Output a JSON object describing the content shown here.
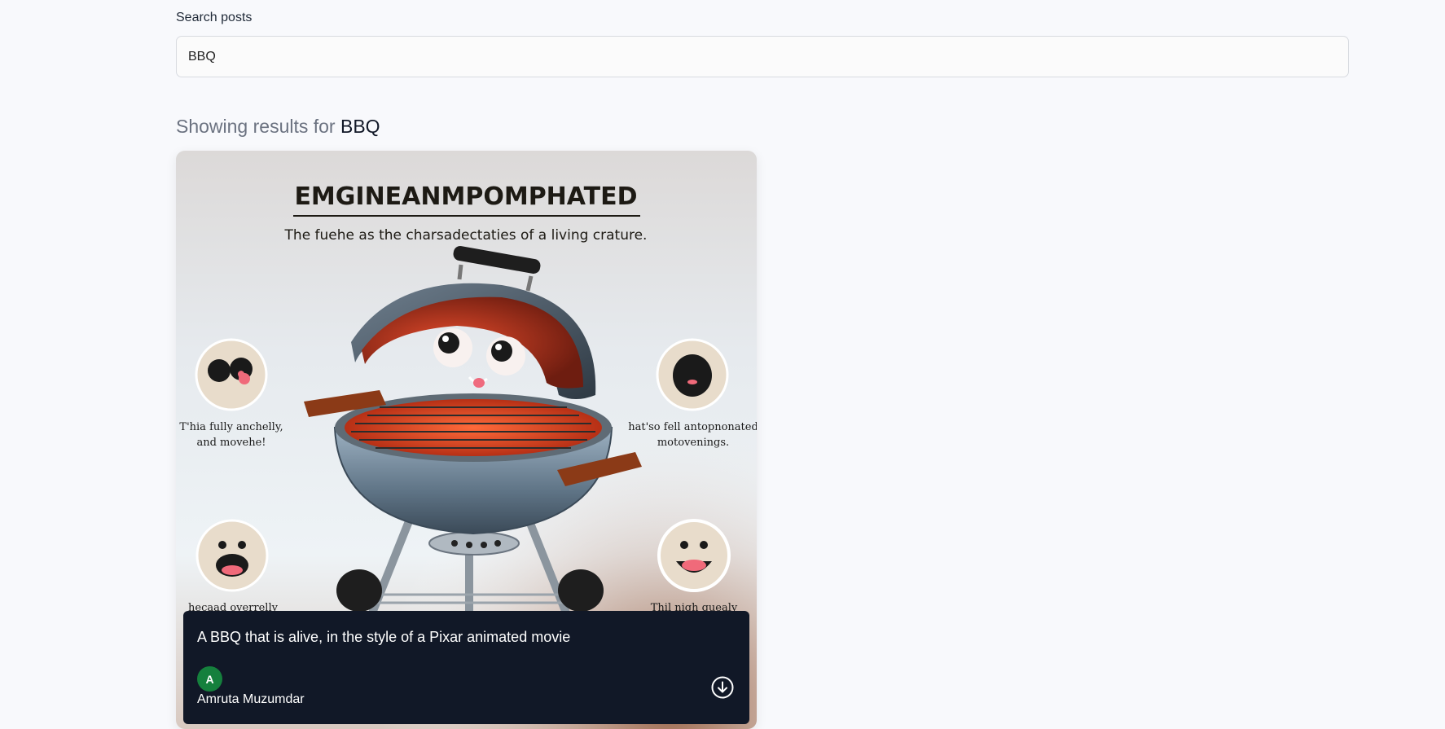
{
  "search": {
    "label": "Search posts",
    "value": "BBQ"
  },
  "results": {
    "prefix": "Showing results for",
    "term": "BBQ"
  },
  "post": {
    "image": {
      "title": "EMGINEANMPOMPHATED",
      "subtitle": "The fuehe as the charsadectaties of a living crature.",
      "labels": {
        "top_left_1": "T'hia fully anchelly,",
        "top_left_2": "and movehe!",
        "top_right_1": "hat'so  fell antopnonated",
        "top_right_2": "motovenings.",
        "bottom_left": "hecaad overrelly",
        "bottom_right": "Thil  nigh quealy"
      }
    },
    "caption": "A BBQ that is alive, in the style of a Pixar animated movie",
    "author_initial": "A",
    "author_name": "Amruta Muzumdar",
    "download_icon": "download-icon"
  },
  "colors": {
    "caption_bg": "#111827",
    "avatar_bg": "#15803d",
    "page_bg": "#f8f9fc"
  }
}
